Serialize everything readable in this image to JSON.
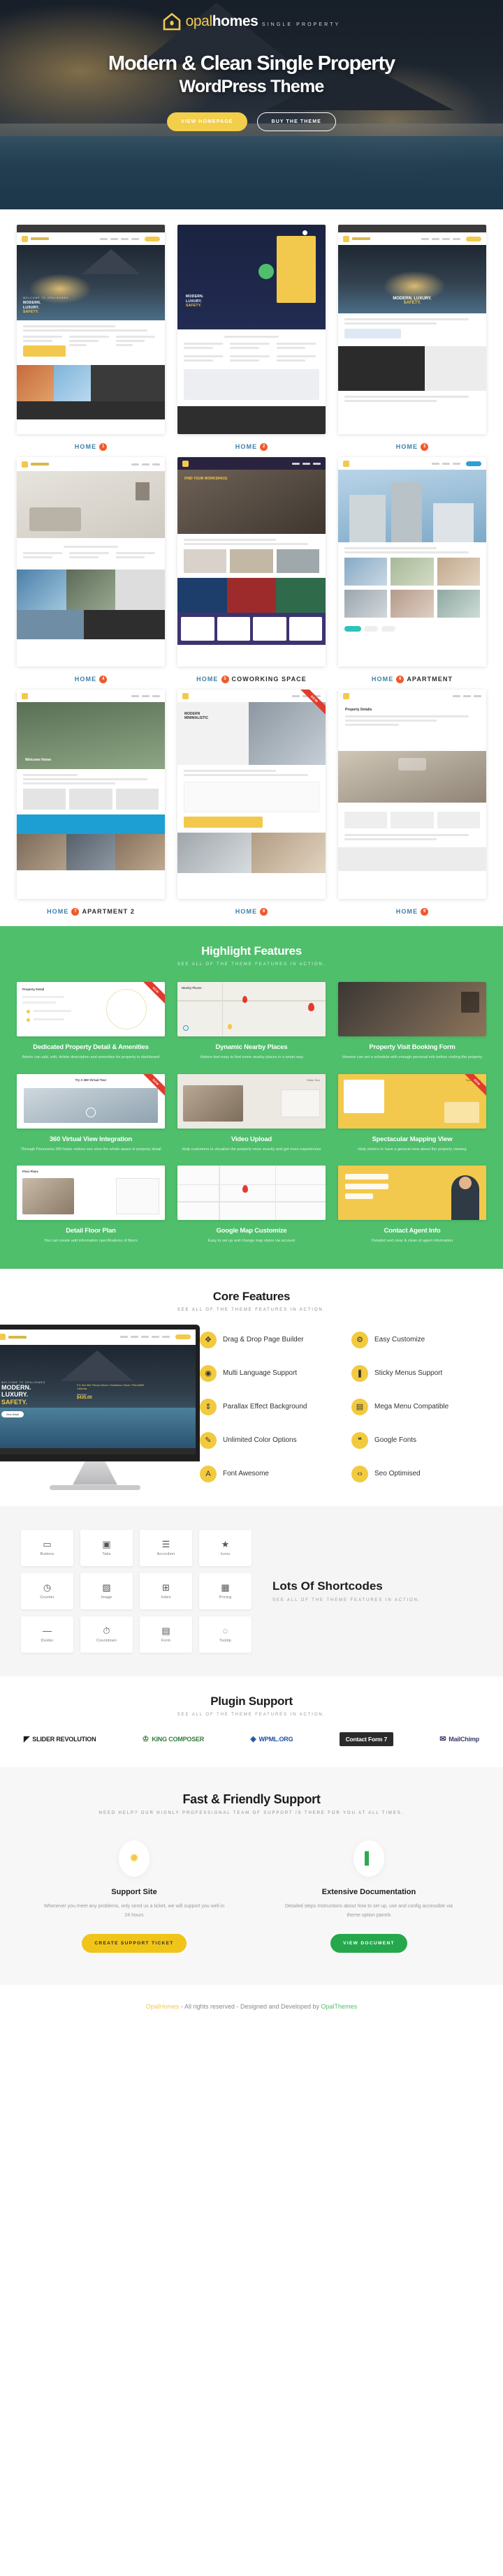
{
  "hero": {
    "logo": {
      "name_light": "opal",
      "name_bold": "homes",
      "tagline": "SINGLE PROPERTY",
      "icon": "house-icon"
    },
    "headline": "Modern & Clean Single Property",
    "subheadline": "WordPress Theme",
    "primary_button": "VIEW HOMEPAGE",
    "secondary_button": "BUY THE THEME"
  },
  "demos": [
    {
      "label": "HOME",
      "num": "1",
      "suffix": "",
      "ribbon": ""
    },
    {
      "label": "HOME",
      "num": "2",
      "suffix": "",
      "ribbon": ""
    },
    {
      "label": "HOME",
      "num": "3",
      "suffix": "",
      "ribbon": ""
    },
    {
      "label": "HOME",
      "num": "4",
      "suffix": "",
      "ribbon": ""
    },
    {
      "label": "HOME",
      "num": "5",
      "suffix": "COWORKING SPACE",
      "ribbon": ""
    },
    {
      "label": "HOME",
      "num": "6",
      "suffix": "APARTMENT",
      "ribbon": ""
    },
    {
      "label": "HOME",
      "num": "7",
      "suffix": "APARTMENT 2",
      "ribbon": ""
    },
    {
      "label": "HOME",
      "num": "8",
      "suffix": "",
      "ribbon": "NEW"
    },
    {
      "label": "HOME",
      "num": "9",
      "suffix": "",
      "ribbon": ""
    }
  ],
  "highlight": {
    "title": "Highlight Features",
    "subtitle": "SEE ALL OF THE THEME FEATURES IN ACTION.",
    "accent_color": "#4fbf6c",
    "cards": [
      {
        "title": "Dedicated Property Detail & Amenities",
        "desc": "Admin can add, edit, delete description and amenities for property in dashboard",
        "ribbon": "NEW",
        "shot": "property-detail-shot"
      },
      {
        "title": "Dynamic Nearby Places",
        "desc": "Visitors feel easy to find some nearby places in a smart way",
        "ribbon": "",
        "shot": "nearby-map-shot"
      },
      {
        "title": "Property Visit Booking Form",
        "desc": "Viewers can set a schedule with enough personal info before visiting the property",
        "ribbon": "",
        "shot": "booking-form-shot"
      },
      {
        "title": "360 Virtual View Integration",
        "desc": "Through Panorama 360 helps visitors see view the whole space in property detail",
        "ribbon": "NEW",
        "shot": "virtual-tour-shot"
      },
      {
        "title": "Video Upload",
        "desc": "Help customers to visualize the property more exactly and get more experiences",
        "ribbon": "",
        "shot": "video-upload-shot"
      },
      {
        "title": "Spectacular Mapping View",
        "desc": "Help visitors to have a general view about the property viewing",
        "ribbon": "NEW",
        "shot": "mapping-view-shot"
      },
      {
        "title": "Detail Floor Plan",
        "desc": "You can create add information specifications of floors",
        "ribbon": "",
        "shot": "floor-plan-shot"
      },
      {
        "title": "Google Map Customize",
        "desc": "Easy to set up and change map styles via account",
        "ribbon": "",
        "shot": "google-map-shot"
      },
      {
        "title": "Contact Agent Info",
        "desc": "Detailed and clear & clean of agent information",
        "ribbon": "",
        "shot": "contact-agent-shot"
      }
    ]
  },
  "core": {
    "title": "Core Features",
    "subtitle": "SEE ALL OF THE THEME FEATURES IN ACTION.",
    "accent_color": "#f2ca3e",
    "screen": {
      "eyebrow": "WELCOME TO OPALHOMES",
      "line1": "MODERN.",
      "line2": "LUXURY.",
      "line3": "SAFETY.",
      "address": "P.O. Box 565, Plency's Beach, Charlottown, Ranch, Phila 64809, California",
      "price_label": "Start From",
      "price": "$435.00",
      "cta": "View Detail"
    },
    "items_left": [
      {
        "icon": "move-icon",
        "glyph": "✥",
        "label": "Drag & Drop Page Builder"
      },
      {
        "icon": "globe-icon",
        "glyph": "◉",
        "label": "Multi Language Support"
      },
      {
        "icon": "layers-icon",
        "glyph": "⇕",
        "label": "Parallax Effect Background"
      },
      {
        "icon": "pencil-icon",
        "glyph": "✎",
        "label": "Unlimited Color Options"
      },
      {
        "icon": "font-awesome-icon",
        "glyph": "A",
        "label": "Font Awesome"
      }
    ],
    "items_right": [
      {
        "icon": "gear-icon",
        "glyph": "⚙",
        "label": "Easy Customize"
      },
      {
        "icon": "bookmark-icon",
        "glyph": "❚",
        "label": "Sticky Menus Support"
      },
      {
        "icon": "grid-icon",
        "glyph": "▤",
        "label": "Mega Menu Compatible"
      },
      {
        "icon": "quote-icon",
        "glyph": "❝",
        "label": "Google Fonts"
      },
      {
        "icon": "code-icon",
        "glyph": "‹›",
        "label": "Seo Optimised"
      }
    ]
  },
  "shortcodes": {
    "title": "Lots Of Shortcodes",
    "subtitle": "SEE ALL OF THE THEME FEATURES IN ACTION.",
    "tiles": [
      {
        "icon": "buttons-icon",
        "glyph": "▭",
        "name": "Buttons"
      },
      {
        "icon": "tabs-icon",
        "glyph": "▣",
        "name": "Tabs"
      },
      {
        "icon": "accordion-icon",
        "glyph": "☰",
        "name": "Accordion"
      },
      {
        "icon": "icons-icon",
        "glyph": "★",
        "name": "Icons"
      },
      {
        "icon": "counter-icon",
        "glyph": "◷",
        "name": "Counter"
      },
      {
        "icon": "image-icon",
        "glyph": "▨",
        "name": "Image"
      },
      {
        "icon": "index-icon",
        "glyph": "⊞",
        "name": "Index"
      },
      {
        "icon": "pricing-icon",
        "glyph": "▦",
        "name": "Pricing"
      },
      {
        "icon": "divider-icon",
        "glyph": "―",
        "name": "Divider"
      },
      {
        "icon": "countdown-icon",
        "glyph": "⏱",
        "name": "Countdown"
      },
      {
        "icon": "form-icon",
        "glyph": "▤",
        "name": "Form"
      },
      {
        "icon": "tooltip-icon",
        "glyph": "◌",
        "name": "Tooltip"
      }
    ]
  },
  "plugins": {
    "title": "Plugin Support",
    "subtitle": "SEE ALL OF THE THEME FEATURES IN ACTION.",
    "items": [
      {
        "name": "SLIDER REVOLUTION",
        "mark": "◤",
        "key": "slider"
      },
      {
        "name": "KING COMPOSER",
        "mark": "♔",
        "key": "kc"
      },
      {
        "name": "WPML.ORG",
        "mark": "◈",
        "key": "wpml"
      },
      {
        "name": "Contact Form 7",
        "mark": "",
        "key": "cf7"
      },
      {
        "name": "MailChimp",
        "mark": "✉",
        "key": "mc"
      }
    ]
  },
  "support": {
    "title": "Fast & Friendly Support",
    "subtitle": "NEED HELP? OUR HIGNLY PROFESSIONAL TEAM OF SUPPORT IS THERE FOR YOU AT ALL TIMES.",
    "cards": [
      {
        "icon": "lifebuoy-icon",
        "glyph": "✹",
        "title": "Support Site",
        "desc": "Whenever you meet any problems, only send us a ticket, we will support you well in 24 hours",
        "button": "CREATE SUPPORT TICKET",
        "color": "#f0c419"
      },
      {
        "icon": "book-icon",
        "glyph": "▌",
        "title": "Extensive Documentation",
        "desc": "Detailed steps Instructions about how to set up, use and config accessible via theme option panels",
        "button": "VIEW DOCUMENT",
        "color": "#25a84c"
      }
    ]
  },
  "footer": {
    "brand": "OpalHomes",
    "middle": " - All rights reserved - Designed and Developed by ",
    "author": "OpalThemes"
  }
}
